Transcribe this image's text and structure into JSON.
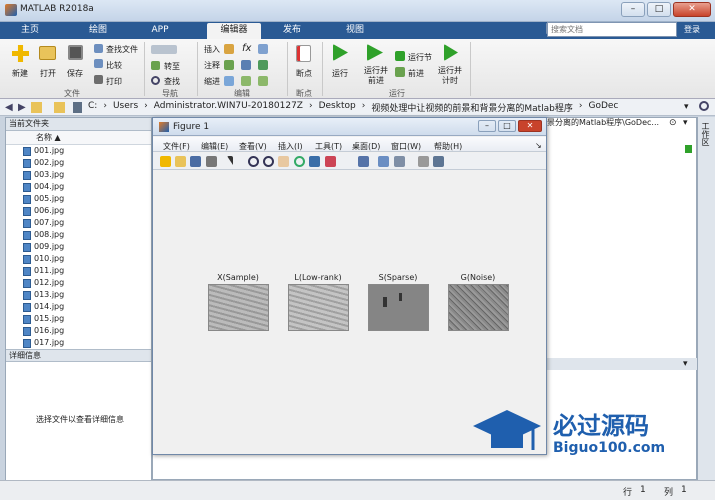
{
  "window": {
    "title": "MATLAB R2018a"
  },
  "tabs": [
    "主页",
    "绘图",
    "APP",
    "编辑器",
    "发布",
    "视图"
  ],
  "search": {
    "placeholder": "搜索文档"
  },
  "login": "登录",
  "ribbon": {
    "file_labels": [
      "新建",
      "打开",
      "保存",
      "查找文件",
      "比较",
      "打印"
    ],
    "nav_labels": [
      "转至",
      "查找"
    ],
    "edit_labels": [
      "插入",
      "注释",
      "缩进",
      "fx"
    ],
    "breakpoint": "断点",
    "run_labels": [
      "运行",
      "运行并前进",
      "运行节",
      "前进",
      "运行并计时"
    ],
    "sections": [
      "文件",
      "导航",
      "编辑",
      "断点",
      "运行"
    ]
  },
  "address": {
    "parts": [
      "C:",
      "Users",
      "Administrator.WIN7U-20180127Z",
      "Desktop",
      "视频处理中让视频的前景和背景分离的Matlab程序",
      "GoDec"
    ]
  },
  "current_folder": {
    "title": "当前文件夹",
    "column": "名称",
    "files": [
      "001.jpg",
      "002.jpg",
      "003.jpg",
      "004.jpg",
      "005.jpg",
      "006.jpg",
      "007.jpg",
      "008.jpg",
      "009.jpg",
      "010.jpg",
      "011.jpg",
      "012.jpg",
      "013.jpg",
      "014.jpg",
      "015.jpg",
      "016.jpg",
      "017.jpg"
    ]
  },
  "details": {
    "title": "详细信息",
    "empty": "选择文件以查看详细信息"
  },
  "editor_tab": "景分离的Matlab程序\\GoDec...",
  "workspace_vertical": "工作区",
  "status": {
    "row_label": "行",
    "row": "1",
    "col_label": "列",
    "col": "1"
  },
  "figure": {
    "title": "Figure 1",
    "menu": [
      "文件(F)",
      "编辑(E)",
      "查看(V)",
      "插入(I)",
      "工具(T)",
      "桌面(D)",
      "窗口(W)",
      "帮助(H)"
    ],
    "subplots": [
      "X(Sample)",
      "L(Low-rank)",
      "S(Sparse)",
      "G(Noise)"
    ]
  },
  "watermark": {
    "cn": "必过源码",
    "url": "Biguo100.com"
  }
}
